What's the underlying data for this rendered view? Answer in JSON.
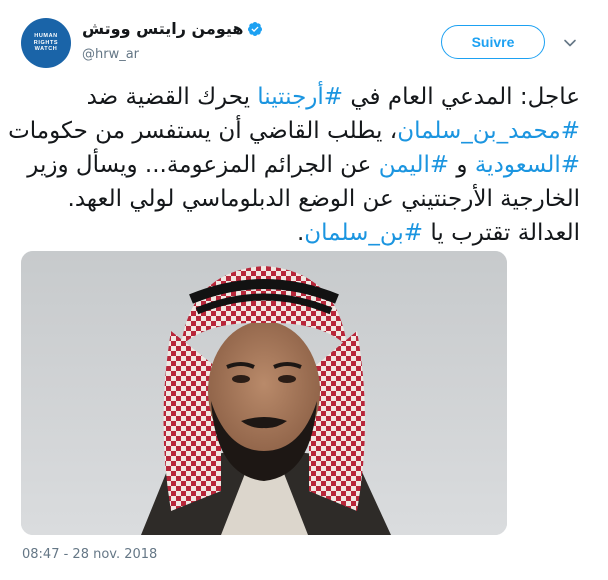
{
  "account": {
    "display_name": "هيومن رايتس ووتش",
    "handle": "@hrw_ar",
    "avatar_lines": [
      "HUMAN",
      "RIGHTS",
      "WATCH"
    ],
    "verified": true
  },
  "follow_button": {
    "label": "Suivre"
  },
  "tweet": {
    "lines": [
      [
        {
          "t": "عاجل: المدعي العام في ",
          "h": false
        },
        {
          "t": "#أرجنتينا",
          "h": true
        },
        {
          "t": " يحرك القضية ضد",
          "h": false
        }
      ],
      [
        {
          "t": "#محمد_بن_سلمان",
          "h": true
        },
        {
          "t": "، يطلب القاضي أن يستفسر من حكومات",
          "h": false
        }
      ],
      [
        {
          "t": "#السعودية",
          "h": true
        },
        {
          "t": " و ",
          "h": false
        },
        {
          "t": "#اليمن",
          "h": true
        },
        {
          "t": " عن الجرائم المزعومة... ويسأل وزير",
          "h": false
        }
      ],
      [
        {
          "t": "الخارجية الأرجنتيني عن الوضع الدبلوماسي لولي العهد.",
          "h": false
        }
      ],
      [
        {
          "t": "العدالة تقترب يا ",
          "h": false
        },
        {
          "t": "#بن_سلمان",
          "h": true
        },
        {
          "t": ".",
          "h": false
        }
      ]
    ]
  },
  "timestamp": "08:47 - 28 nov. 2018",
  "colors": {
    "link": "#1b95e0",
    "follow": "#1da1f2",
    "verified": "#1da1f2",
    "avatar": "#1a64a8",
    "muted": "#657786"
  }
}
